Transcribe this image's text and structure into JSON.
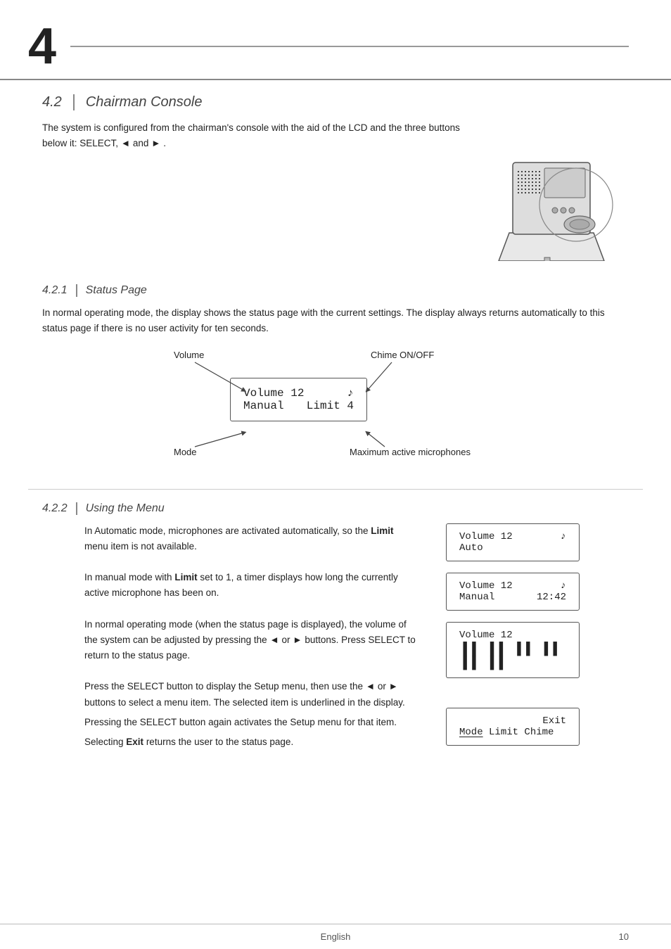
{
  "chapter": {
    "number": "4",
    "section_4_2": {
      "title": "Chairman Console",
      "num": "4.2",
      "intro": "The system is configured from the chairman's console with the aid of the LCD and the three buttons below it: SELECT, ◄ and ► ."
    },
    "section_4_2_1": {
      "title": "Status Page",
      "num": "4.2.1",
      "description": "In normal operating mode, the display shows the status page with the current settings. The display always returns automatically to this status page if there is no user activity for ten seconds.",
      "diagram": {
        "label_volume": "Volume",
        "label_chime": "Chime ON/OFF",
        "label_mode": "Mode",
        "label_max_mic": "Maximum active microphones",
        "lcd_line1": "Volume 12",
        "lcd_line2_left": "Manual",
        "lcd_line2_right": "Limit 4",
        "chime_icon": "♪"
      }
    },
    "section_4_2_2": {
      "title": "Using the Menu",
      "num": "4.2.2",
      "paragraphs": [
        {
          "text": "In Automatic mode, microphones are activated automatically, so the ",
          "bold": "Limit",
          "text2": " menu item is not available.",
          "lcd1": "Volume 12",
          "lcd2": "Auto",
          "chime": "♪"
        },
        {
          "text": "In manual mode with ",
          "bold": "Limit",
          "text2": " set to 1, a timer displays how long the currently active microphone has been on.",
          "lcd1": "Volume 12",
          "lcd2_left": "Manual",
          "lcd2_right": "12:42",
          "chime": "♪"
        },
        {
          "text": "In normal operating mode (when the status page is displayed), the volume of the system can be adjusted by pressing the ◄ or ► buttons. Press SELECT to return to the status page.",
          "lcd1": "Volume 12",
          "lcd2_bars": "▐ ▐▐ ▐▐ ▐▐ ▐▐ ▐▐"
        },
        {
          "text": "Press the SELECT button to display the Setup menu, then use the ◄ or ► buttons to select a menu item. The selected item is underlined in the display.",
          "text2": "Pressing the SELECT button again activates the Setup menu for that item.",
          "text3": "Selecting ",
          "bold2": "Exit",
          "text4": " returns the user to the status page.",
          "lcd_exit": "Exit",
          "lcd_menu": "Mode Limit Chime",
          "menu_underline": "Mode"
        }
      ]
    }
  },
  "footer": {
    "language": "English",
    "page_number": "10"
  }
}
